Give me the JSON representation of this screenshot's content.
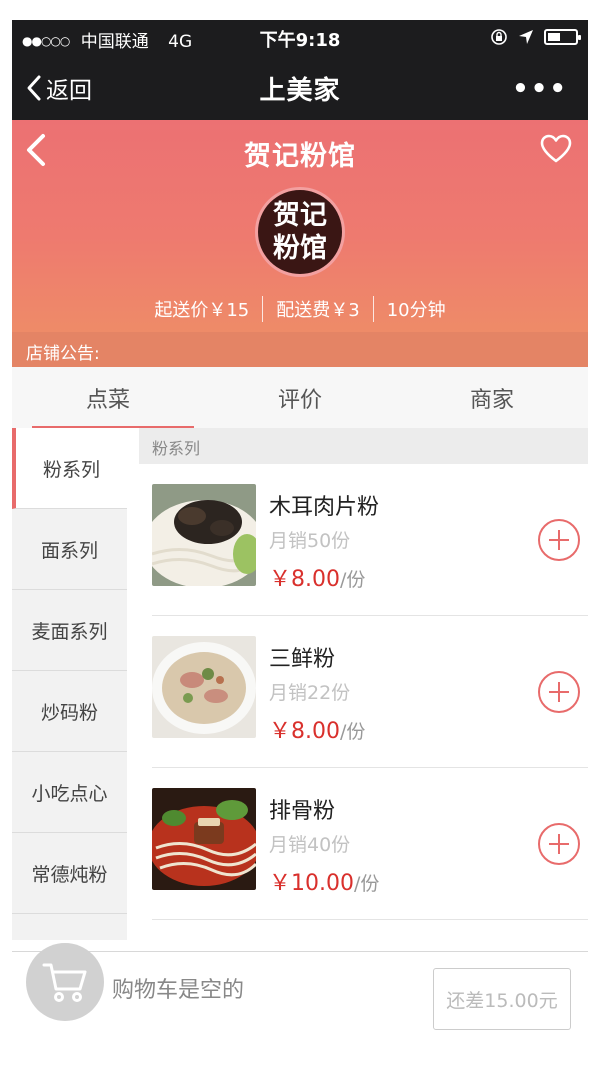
{
  "status_bar": {
    "signal": "●●○○○",
    "carrier": "中国联通",
    "network": "4G",
    "time": "下午9:18"
  },
  "navbar": {
    "back_label": "返回",
    "title": "上美家",
    "more": "•••"
  },
  "store": {
    "name": "贺记粉馆",
    "logo_line1": "贺记",
    "logo_line2": "粉馆",
    "min_order": "起送价￥15",
    "delivery_fee": "配送费￥3",
    "delivery_time": "10分钟",
    "notice_label": "店铺公告:",
    "accent_color": "#ec7173"
  },
  "tabs": [
    {
      "label": "点菜",
      "active": true
    },
    {
      "label": "评价",
      "active": false
    },
    {
      "label": "商家",
      "active": false
    }
  ],
  "categories": [
    {
      "label": "粉系列",
      "active": true
    },
    {
      "label": "面系列"
    },
    {
      "label": "麦面系列"
    },
    {
      "label": "炒码粉"
    },
    {
      "label": "小吃点心"
    },
    {
      "label": "常德炖粉"
    }
  ],
  "menu": {
    "section_title": "粉系列",
    "items": [
      {
        "name": "木耳肉片粉",
        "sales": "月销50份",
        "price": "￥8.00",
        "unit": "/份",
        "image_icon": "noodle-with-wood-ear-icon"
      },
      {
        "name": "三鲜粉",
        "sales": "月销22份",
        "price": "￥8.00",
        "unit": "/份",
        "image_icon": "three-fresh-noodle-soup-icon"
      },
      {
        "name": "排骨粉",
        "sales": "月销40份",
        "price": "￥10.00",
        "unit": "/份",
        "image_icon": "spare-rib-noodle-icon"
      }
    ]
  },
  "cart": {
    "status": "购物车是空的",
    "button_label": "还差15.00元"
  }
}
